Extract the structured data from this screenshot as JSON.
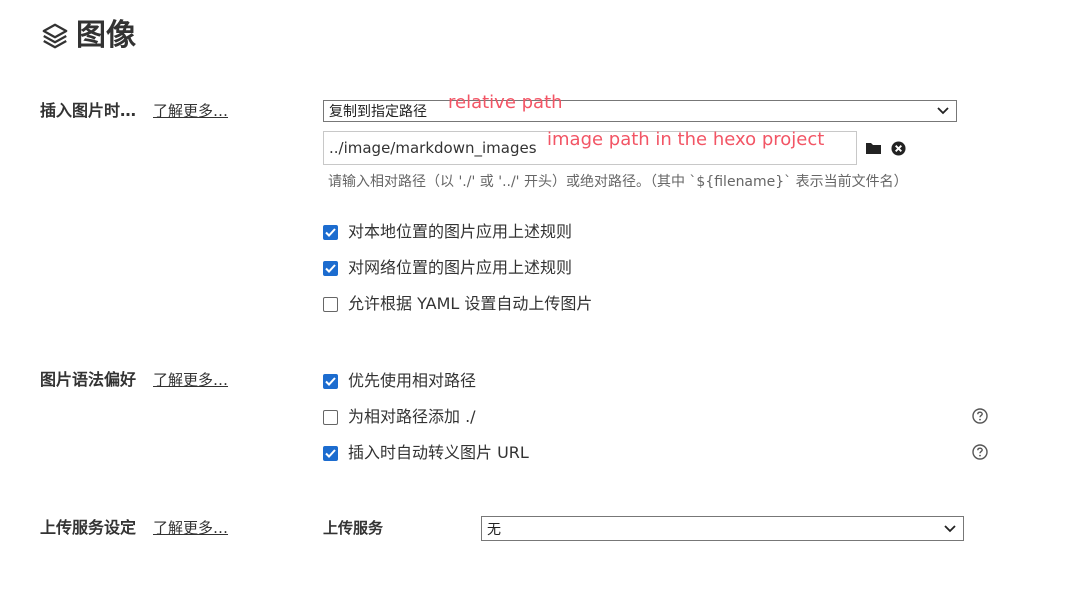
{
  "header": {
    "title": "图像",
    "icon": "layers-icon"
  },
  "insert_section": {
    "label": "插入图片时…",
    "learn_more": "了解更多…",
    "action_select": {
      "value": "复制到指定路径"
    },
    "path_input": {
      "value": "../image/markdown_images"
    },
    "hint": "请输入相对路径（以 './' 或 '../' 开头）或绝对路径。（其中 `${filename}` 表示当前文件名）",
    "options": [
      {
        "label": "对本地位置的图片应用上述规则",
        "checked": true
      },
      {
        "label": "对网络位置的图片应用上述规则",
        "checked": true
      },
      {
        "label": "允许根据 YAML 设置自动上传图片",
        "checked": false
      }
    ]
  },
  "syntax_section": {
    "label": "图片语法偏好",
    "learn_more": "了解更多…",
    "options": [
      {
        "label": "优先使用相对路径",
        "checked": true
      },
      {
        "label": "为相对路径添加 ./",
        "checked": false
      },
      {
        "label": "插入时自动转义图片 URL",
        "checked": true
      }
    ]
  },
  "upload_section": {
    "label": "上传服务设定",
    "learn_more": "了解更多…",
    "service_label": "上传服务",
    "service_select": {
      "value": "无"
    }
  },
  "annotations": {
    "relative_path": "relative path",
    "image_path": "image path in the hexo project"
  },
  "colors": {
    "accent": "#1c6ccf",
    "annotation": "#f25565"
  }
}
